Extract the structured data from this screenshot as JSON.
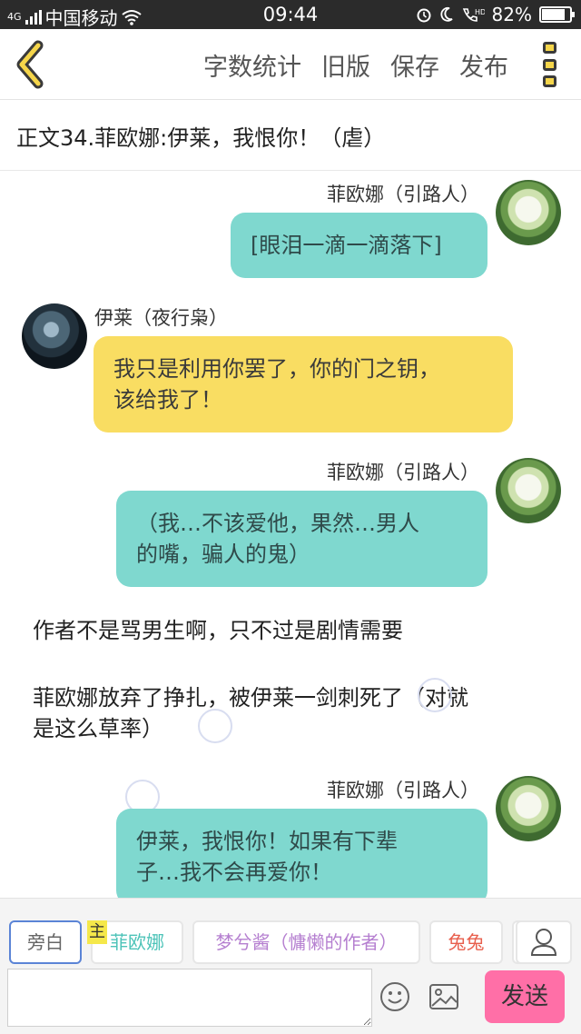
{
  "status_bar": {
    "network": "4G",
    "carrier": "中国移动",
    "time": "09:44",
    "battery": "82%",
    "battery_level": 0.82
  },
  "nav": {
    "actions": [
      "字数统计",
      "旧版",
      "保存",
      "发布"
    ]
  },
  "chapter": {
    "title": "正文34.菲欧娜:伊莱，我恨你！（虐）"
  },
  "messages": [
    {
      "speaker": "菲欧娜（引路人）",
      "lines": [
        "[眼泪一滴一滴落下]"
      ]
    },
    {
      "speaker": "伊莱（夜行枭）",
      "lines": [
        "我只是利用你罢了，你的门之钥，",
        "该给我了！"
      ]
    },
    {
      "speaker": "菲欧娜（引路人）",
      "lines": [
        "（我…不该爱他，果然…男人",
        "的嘴，骗人的鬼）"
      ]
    },
    {
      "narration": [
        "作者不是骂男生啊，只不过是剧情需要"
      ]
    },
    {
      "narration": [
        "菲欧娜放弃了挣扎，被伊莱一剑刺死了（对就",
        "是这么草率）"
      ]
    },
    {
      "speaker": "菲欧娜（引路人）",
      "lines": [
        "伊莱，我恨你！如果有下辈",
        "子…我不会再爱你！"
      ]
    }
  ],
  "roles": {
    "narrator": "旁白",
    "main_tag": "主",
    "role1": "菲欧娜",
    "role2": "梦兮酱（慵懒的作者）",
    "role3": "兔兔"
  },
  "composer": {
    "send_label": "发送"
  },
  "colors": {
    "teal_bubble": "#7fd8cf",
    "yellow_bubble": "#f9dd62",
    "send_button": "#ff6fa7",
    "role1_text": "#4cc3b8",
    "role2_text": "#b57fd0",
    "role3_text": "#e85f4d"
  },
  "icons": {
    "back": "chevron-left-icon",
    "more": "more-vertical-icon",
    "emoji": "smiley-icon",
    "image": "image-icon",
    "profile": "person-icon"
  }
}
